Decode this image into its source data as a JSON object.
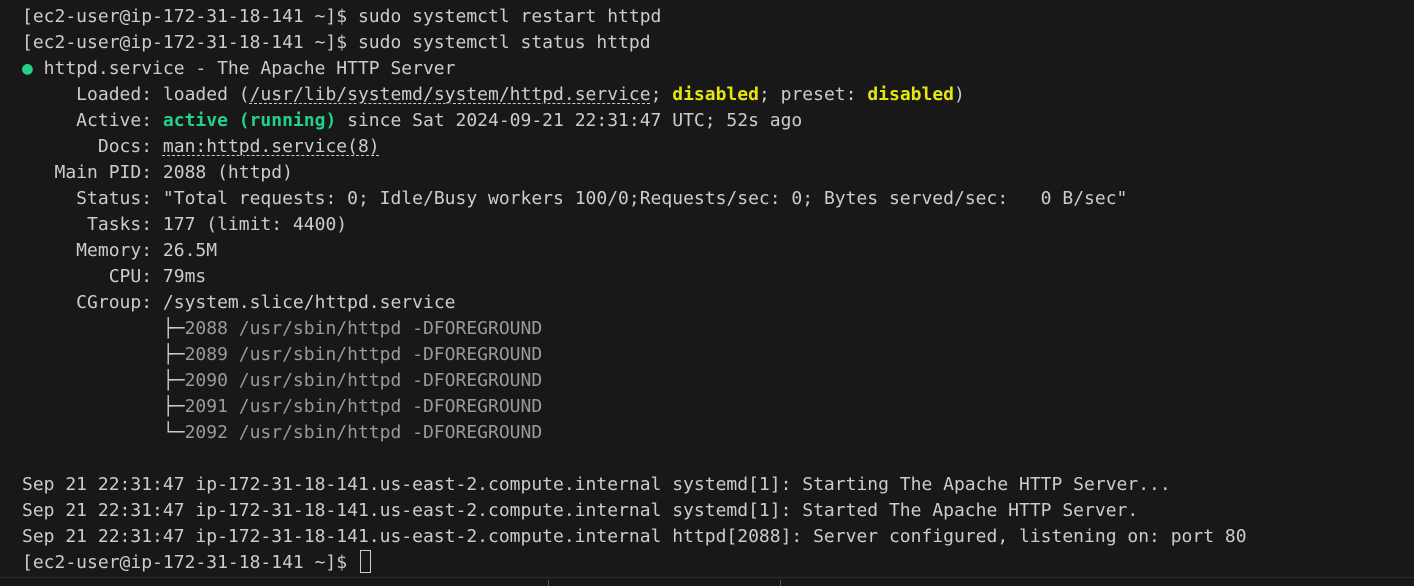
{
  "prompt": "[ec2-user@ip-172-31-18-141 ~]$ ",
  "commands": [
    "sudo systemctl restart httpd",
    "sudo systemctl status httpd"
  ],
  "service": {
    "bullet": "●",
    "header": " httpd.service - The Apache HTTP Server",
    "loaded_label": "     Loaded: ",
    "loaded_pre": "loaded (",
    "loaded_path": "/usr/lib/systemd/system/httpd.service",
    "loaded_sep1": "; ",
    "loaded_state": "disabled",
    "loaded_sep2": "; preset: ",
    "preset_state": "disabled",
    "loaded_post": ")",
    "active_label": "     Active: ",
    "active_state": "active (running)",
    "active_since": " since Sat 2024-09-21 22:31:47 UTC; 52s ago",
    "docs_label": "       Docs: ",
    "docs_value": "man:httpd.service(8)",
    "pid_label": "   Main PID: ",
    "pid_value": "2088 (httpd)",
    "status_label": "     Status: ",
    "status_value": "\"Total requests: 0; Idle/Busy workers 100/0;Requests/sec: 0; Bytes served/sec:   0 B/sec\"",
    "tasks_label": "      Tasks: ",
    "tasks_value": "177 (limit: 4400)",
    "memory_label": "     Memory: ",
    "memory_value": "26.5M",
    "cpu_label": "        CPU: ",
    "cpu_value": "79ms",
    "cgroup_label": "     CGroup: ",
    "cgroup_value": "/system.slice/httpd.service",
    "cgroup_procs": [
      {
        "tree": "             ├─",
        "cmd": "2088 /usr/sbin/httpd -DFOREGROUND"
      },
      {
        "tree": "             ├─",
        "cmd": "2089 /usr/sbin/httpd -DFOREGROUND"
      },
      {
        "tree": "             ├─",
        "cmd": "2090 /usr/sbin/httpd -DFOREGROUND"
      },
      {
        "tree": "             ├─",
        "cmd": "2091 /usr/sbin/httpd -DFOREGROUND"
      },
      {
        "tree": "             └─",
        "cmd": "2092 /usr/sbin/httpd -DFOREGROUND"
      }
    ]
  },
  "logs": [
    "Sep 21 22:31:47 ip-172-31-18-141.us-east-2.compute.internal systemd[1]: Starting The Apache HTTP Server...",
    "Sep 21 22:31:47 ip-172-31-18-141.us-east-2.compute.internal systemd[1]: Started The Apache HTTP Server.",
    "Sep 21 22:31:47 ip-172-31-18-141.us-east-2.compute.internal httpd[2088]: Server configured, listening on: port 80"
  ],
  "colors": {
    "background": "#181818",
    "text": "#cccccc",
    "active": "#23d18b",
    "disabled": "#e5e510",
    "cgroup": "#9a9a9a"
  }
}
